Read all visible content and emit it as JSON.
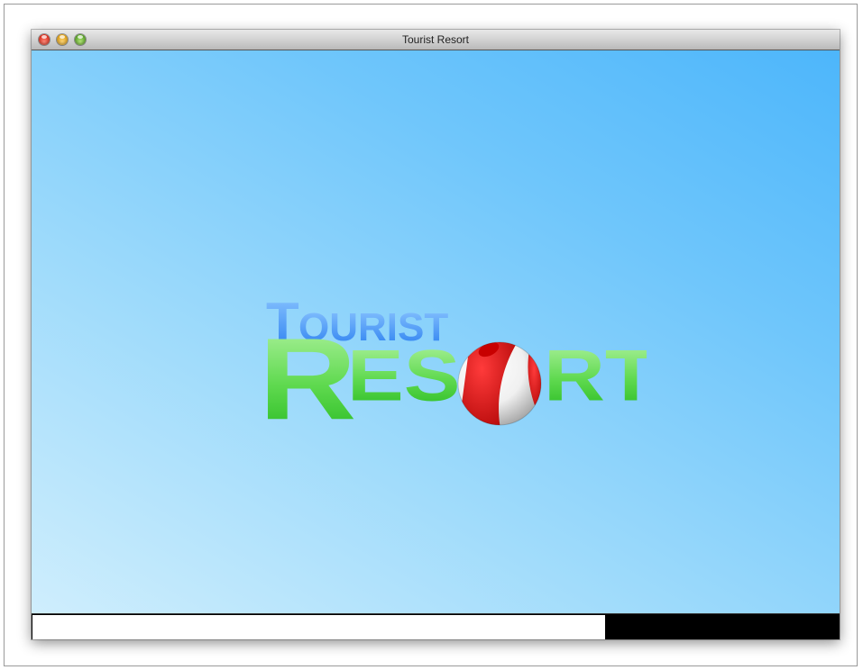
{
  "window": {
    "title": "Tourist Resort",
    "controls": [
      "close-icon",
      "minimize-icon",
      "zoom-icon"
    ]
  },
  "logo": {
    "line1": "TOURIST",
    "line2": "RESORT",
    "ball_icon": "beach-ball-icon",
    "colors": {
      "line1": "#3a8ff0",
      "line2": "#3fc93a",
      "ball": "#d91414"
    }
  },
  "loading": {
    "progress_percent": 71
  },
  "colors": {
    "background_top_right": "#4db6fb",
    "background_bottom_left": "#cfeefd"
  }
}
